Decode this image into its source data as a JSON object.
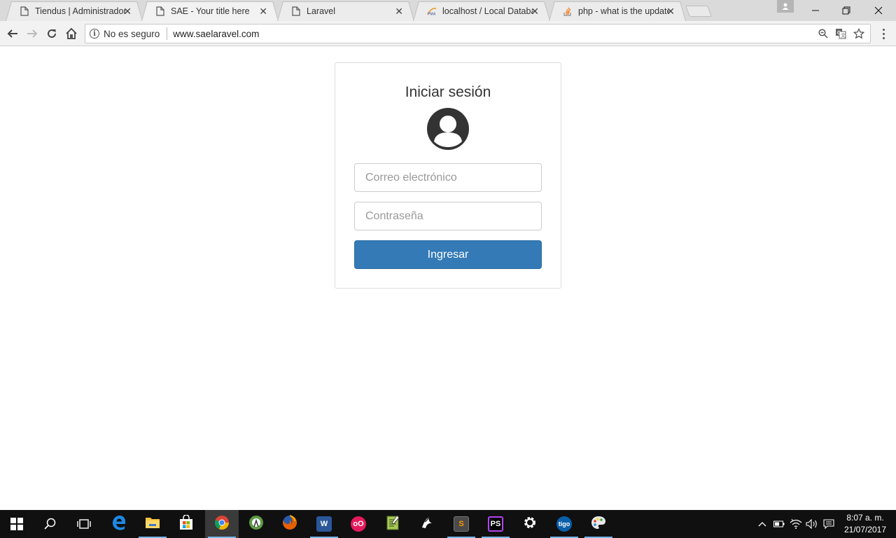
{
  "browser": {
    "tabs": [
      {
        "title": "Tiendus | Administrador",
        "icon": "page-icon",
        "active": false
      },
      {
        "title": "SAE - Your title here",
        "icon": "page-icon",
        "active": true
      },
      {
        "title": "Laravel",
        "icon": "page-icon",
        "active": false
      },
      {
        "title": "localhost / Local Databas",
        "icon": "phpmyadmin-icon",
        "active": false
      },
      {
        "title": "php - what is the update",
        "icon": "stackoverflow-icon",
        "active": false
      }
    ],
    "close_glyph": "✕",
    "security_label": "No es seguro",
    "url": "www.saelaravel.com"
  },
  "login": {
    "title": "Iniciar sesión",
    "email_placeholder": "Correo electrónico",
    "password_placeholder": "Contraseña",
    "submit_label": "Ingresar",
    "accent_color": "#337ab7"
  },
  "taskbar": {
    "apps": [
      {
        "name": "edge",
        "icon": "edge-icon"
      },
      {
        "name": "file-explorer",
        "icon": "folder-icon"
      },
      {
        "name": "store",
        "icon": "store-icon"
      },
      {
        "name": "chrome",
        "icon": "chrome-icon"
      },
      {
        "name": "android-studio",
        "icon": "android-studio-icon"
      },
      {
        "name": "firefox",
        "icon": "firefox-icon"
      },
      {
        "name": "word",
        "icon": "word-icon",
        "label": "W"
      },
      {
        "name": "flickr",
        "icon": "flickr-icon",
        "label": "oO"
      },
      {
        "name": "notepad",
        "icon": "notepad-icon"
      },
      {
        "name": "inkscape",
        "icon": "inkscape-icon"
      },
      {
        "name": "sublime-text",
        "icon": "sublime-icon",
        "label": "S"
      },
      {
        "name": "phpstorm",
        "icon": "phpstorm-icon",
        "label": "PS"
      },
      {
        "name": "settings",
        "icon": "gear-icon"
      },
      {
        "name": "tigo",
        "icon": "tigo-icon",
        "label": "tigo"
      },
      {
        "name": "paint",
        "icon": "palette-icon"
      }
    ],
    "clock_time": "8:07 a. m.",
    "clock_date": "21/07/2017"
  }
}
